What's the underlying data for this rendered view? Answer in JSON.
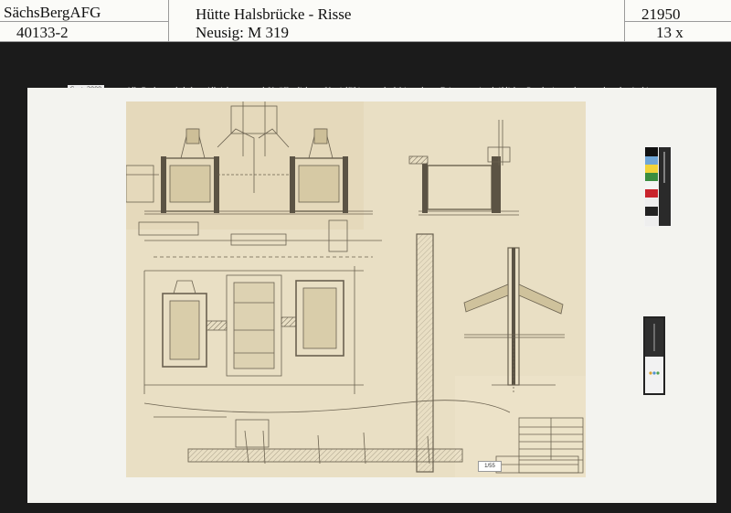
{
  "header": {
    "archive": "SächsBergAFG",
    "fonds": "40133-2",
    "title": "Hütte Halsbrücke - Risse",
    "signature": "Neusig: M 319",
    "number": "21950",
    "count": "13 x"
  },
  "notice": {
    "date": "Sept. 2008",
    "rights": "Alle Rechte vorbehalten. All rights reserved. Veröffentlichung, Vervielfältigung oder Weitergabe an Dritte nur mit schriftlicher Genehmigung des verwahrenden Archivs."
  },
  "drawing": {
    "scan_label": "1/55"
  },
  "colors": {
    "paper": "#e6dcc0",
    "line": "#6b6250",
    "board": "#f3f3ef",
    "background": "#1b1b1b"
  }
}
